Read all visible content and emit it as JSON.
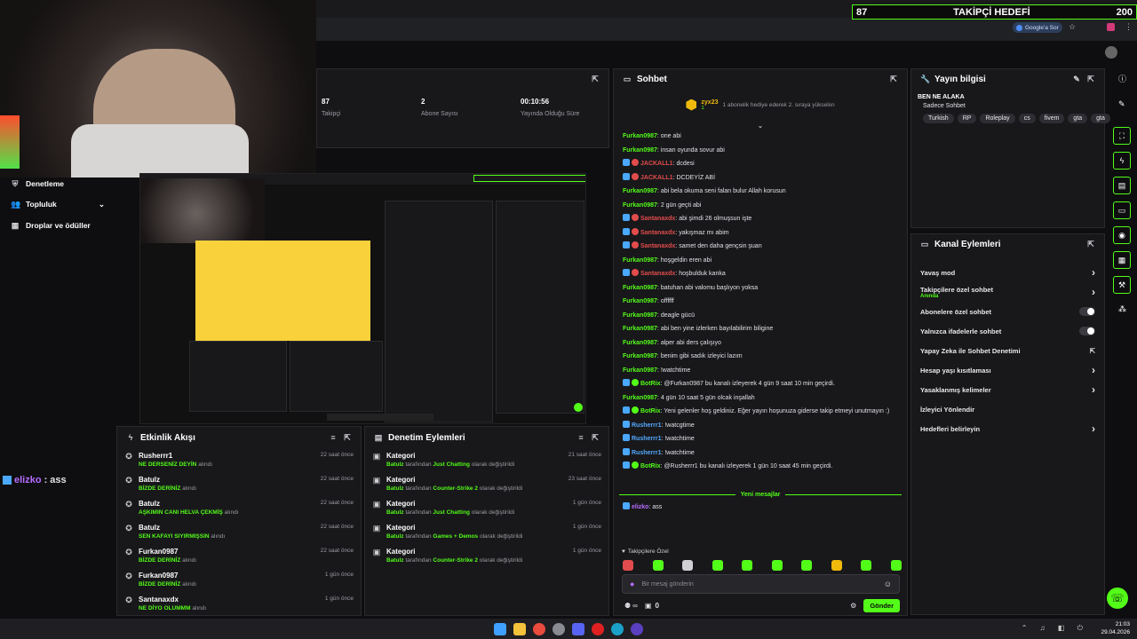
{
  "goal_bar": {
    "current": "87",
    "title": "TAKİPÇİ HEDEFİ",
    "target": "200"
  },
  "browser": {
    "google_ask": "Google'a Sor"
  },
  "nav": {
    "items": [
      {
        "label": "Denetleme"
      },
      {
        "label": "Topluluk"
      },
      {
        "label": "Droplar ve ödüller"
      }
    ]
  },
  "overlay_chat": {
    "user": "elizko",
    "sep": ":",
    "text": "ass"
  },
  "stats": [
    {
      "value": "87",
      "label": "Takipçi"
    },
    {
      "value": "2",
      "label": "Abone Sayısı"
    },
    {
      "value": "00:10:56",
      "label": "Yayında Olduğu Süre"
    }
  ],
  "activity": {
    "title": "Etkinlik Akışı",
    "items": [
      {
        "user": "Rusherrr1",
        "highlight": "NE DERSENİZ DEYİN",
        "suffix": "alındı",
        "time": "22 saat önce"
      },
      {
        "user": "Batulz",
        "highlight": "BİZDE DERİNİZ",
        "suffix": "alındı",
        "time": "22 saat önce"
      },
      {
        "user": "Batulz",
        "highlight": "AŞKIMIN CANI HELVA ÇEKMİŞ",
        "suffix": "alındı",
        "time": "22 saat önce"
      },
      {
        "user": "Batulz",
        "highlight": "SEN KAFAYI SIYIRMIŞSIN",
        "suffix": "alındı",
        "time": "22 saat önce"
      },
      {
        "user": "Furkan0987",
        "highlight": "BİZDE DERİNİZ",
        "suffix": "alındı",
        "time": "22 saat önce"
      },
      {
        "user": "Furkan0987",
        "highlight": "BİZDE DERİNİZ",
        "suffix": "alındı",
        "time": "1 gün önce"
      },
      {
        "user": "Santanaxdx",
        "highlight": "NE DİYO OLUMMM",
        "suffix": "alındı",
        "time": "1 gün önce"
      }
    ]
  },
  "moderation": {
    "title": "Denetim Eylemleri",
    "items": [
      {
        "title": "Kategori",
        "by": "Batulz",
        "mid": "tarafından",
        "target": "Just Chatting",
        "suffix": "olarak değiştirildi",
        "time": "21 saat önce"
      },
      {
        "title": "Kategori",
        "by": "Batulz",
        "mid": "tarafından",
        "target": "Counter-Strike 2",
        "suffix": "olarak değiştirildi",
        "time": "23 saat önce"
      },
      {
        "title": "Kategori",
        "by": "Batulz",
        "mid": "tarafından",
        "target": "Just Chatting",
        "suffix": "olarak değiştirildi",
        "time": "1 gün önce"
      },
      {
        "title": "Kategori",
        "by": "Batulz",
        "mid": "tarafından",
        "target": "Games + Demos",
        "suffix": "olarak değiştirildi",
        "time": "1 gün önce"
      },
      {
        "title": "Kategori",
        "by": "Batulz",
        "mid": "tarafından",
        "target": "Counter-Strike 2",
        "suffix": "olarak değiştirildi",
        "time": "1 gün önce"
      }
    ]
  },
  "chat": {
    "title": "Sohbet",
    "pinned_user": "zyx23",
    "pinned_count": "1",
    "pinned_text": "1 abonelik hediye ederek 2. sıraya yükseliın",
    "messages": [
      {
        "user": "Furkan0987",
        "text": "one abi",
        "cls": "",
        "badges": 0
      },
      {
        "user": "Furkan0987",
        "text": "insan oyunda sovur abi",
        "cls": "",
        "badges": 0
      },
      {
        "user": "JACKALL1",
        "text": "dcdesi",
        "cls": "red",
        "badges": 2
      },
      {
        "user": "JACKALL1",
        "text": "DCDEYİZ ABİ",
        "cls": "red",
        "badges": 2
      },
      {
        "user": "Furkan0987",
        "text": "abi bela okuma seni falan bulur Allah korusun",
        "cls": "",
        "badges": 0
      },
      {
        "user": "Furkan0987",
        "text": "2 gün geçti abi",
        "cls": "",
        "badges": 0
      },
      {
        "user": "Santanaxdx",
        "text": "abi şimdi 26 olmuşsun işte",
        "cls": "red",
        "badges": 2
      },
      {
        "user": "Santanaxdx",
        "text": "yakışmaz mı abim",
        "cls": "red",
        "badges": 2
      },
      {
        "user": "Santanaxdx",
        "text": "samet den daha gençsin şuan",
        "cls": "red",
        "badges": 2
      },
      {
        "user": "Furkan0987",
        "text": "hoşgeldin eren abi",
        "cls": "",
        "badges": 0
      },
      {
        "user": "Santanaxdx",
        "text": "hoşbulduk kanka",
        "cls": "red",
        "badges": 2
      },
      {
        "user": "Furkan0987",
        "text": "batuhan abi valomu başlıyon yoksa",
        "cls": "",
        "badges": 0
      },
      {
        "user": "Furkan0987",
        "text": "offffff",
        "cls": "",
        "badges": 0
      },
      {
        "user": "Furkan0987",
        "text": "deagle gücü",
        "cls": "",
        "badges": 0
      },
      {
        "user": "Furkan0987",
        "text": "abi ben yine izlerken bayılabilirim biligine",
        "cls": "",
        "badges": 0
      },
      {
        "user": "Furkan0987",
        "text": "alper abi ders çalışıyo",
        "cls": "",
        "badges": 0
      },
      {
        "user": "Furkan0987",
        "text": "benim gibi sadık izleyici lazım",
        "cls": "",
        "badges": 0
      },
      {
        "user": "Furkan0987",
        "text": "!watchtime",
        "cls": "",
        "badges": 0
      },
      {
        "user": "BotRix",
        "text": "@Furkan0987 bu kanalı izleyerek 4 gün 9 saat 10 min geçirdi.",
        "cls": "",
        "badges": 2
      },
      {
        "user": "Furkan0987",
        "text": "4 gün 10 saat 5 gün olcak inşallah",
        "cls": "",
        "badges": 0
      },
      {
        "user": "BotRix",
        "text": "Yeni gelenler hoş geldiniz. Eğer yayın hoşunuza giderse takip etmeyi unutmayın :)",
        "cls": "",
        "badges": 2
      },
      {
        "user": "Rusherrr1",
        "text": "!watcgtime",
        "cls": "blue",
        "badges": 1
      },
      {
        "user": "Rusherrr1",
        "text": "!watchtime",
        "cls": "blue",
        "badges": 1
      },
      {
        "user": "Rusherrr1",
        "text": "!watchtime",
        "cls": "blue",
        "badges": 1
      },
      {
        "user": "BotRix",
        "text": "@Rusherrr1 bu kanalı izleyerek 1 gün 10 saat 45 min geçirdi.",
        "cls": "",
        "badges": 2
      }
    ],
    "new_messages_label": "Yeni mesajlar",
    "last_message": {
      "user": "elizko",
      "text": "ass"
    },
    "followers_only_label": "Takipçilere Özel",
    "input_placeholder": "Bir mesaj gönderin",
    "send_label": "Gönder",
    "infinity": "∞",
    "count_zero": "0"
  },
  "stream_info": {
    "title": "Yayın bilgisi",
    "stream_title": "BEN NE ALAKA",
    "category": "Sadece Sohbet",
    "tags": [
      "Turkish",
      "RP",
      "Roleplay",
      "cs",
      "fivem",
      "gta",
      "gta"
    ]
  },
  "channel_actions": {
    "title": "Kanal Eylemleri",
    "rows": [
      {
        "label": "Yavaş mod",
        "sub": "",
        "ctrl": "chevron"
      },
      {
        "label": "Takipçilere özel sohbet",
        "sub": "Anında",
        "ctrl": "chevron"
      },
      {
        "label": "Abonelere özel sohbet",
        "sub": "",
        "ctrl": "toggle"
      },
      {
        "label": "Yalnızca ifadelerle sohbet",
        "sub": "",
        "ctrl": "toggle"
      },
      {
        "label": "Yapay Zeka ile Sohbet Denetimi",
        "sub": "",
        "ctrl": "external"
      },
      {
        "label": "Hesap yaşı kısıtlaması",
        "sub": "",
        "ctrl": "chevron"
      },
      {
        "label": "Yasaklanmış kelimeler",
        "sub": "",
        "ctrl": "chevron"
      },
      {
        "label": "İzleyici Yönlendir",
        "sub": "",
        "ctrl": "none"
      },
      {
        "label": "Hedefleri belirleyin",
        "sub": "",
        "ctrl": "chevron"
      }
    ]
  },
  "taskbar": {
    "time": "21:03",
    "date": "29.04.2026"
  },
  "colors": {
    "accent": "#53fc18",
    "bg": "#0e0e10",
    "panel": "#18181b"
  }
}
